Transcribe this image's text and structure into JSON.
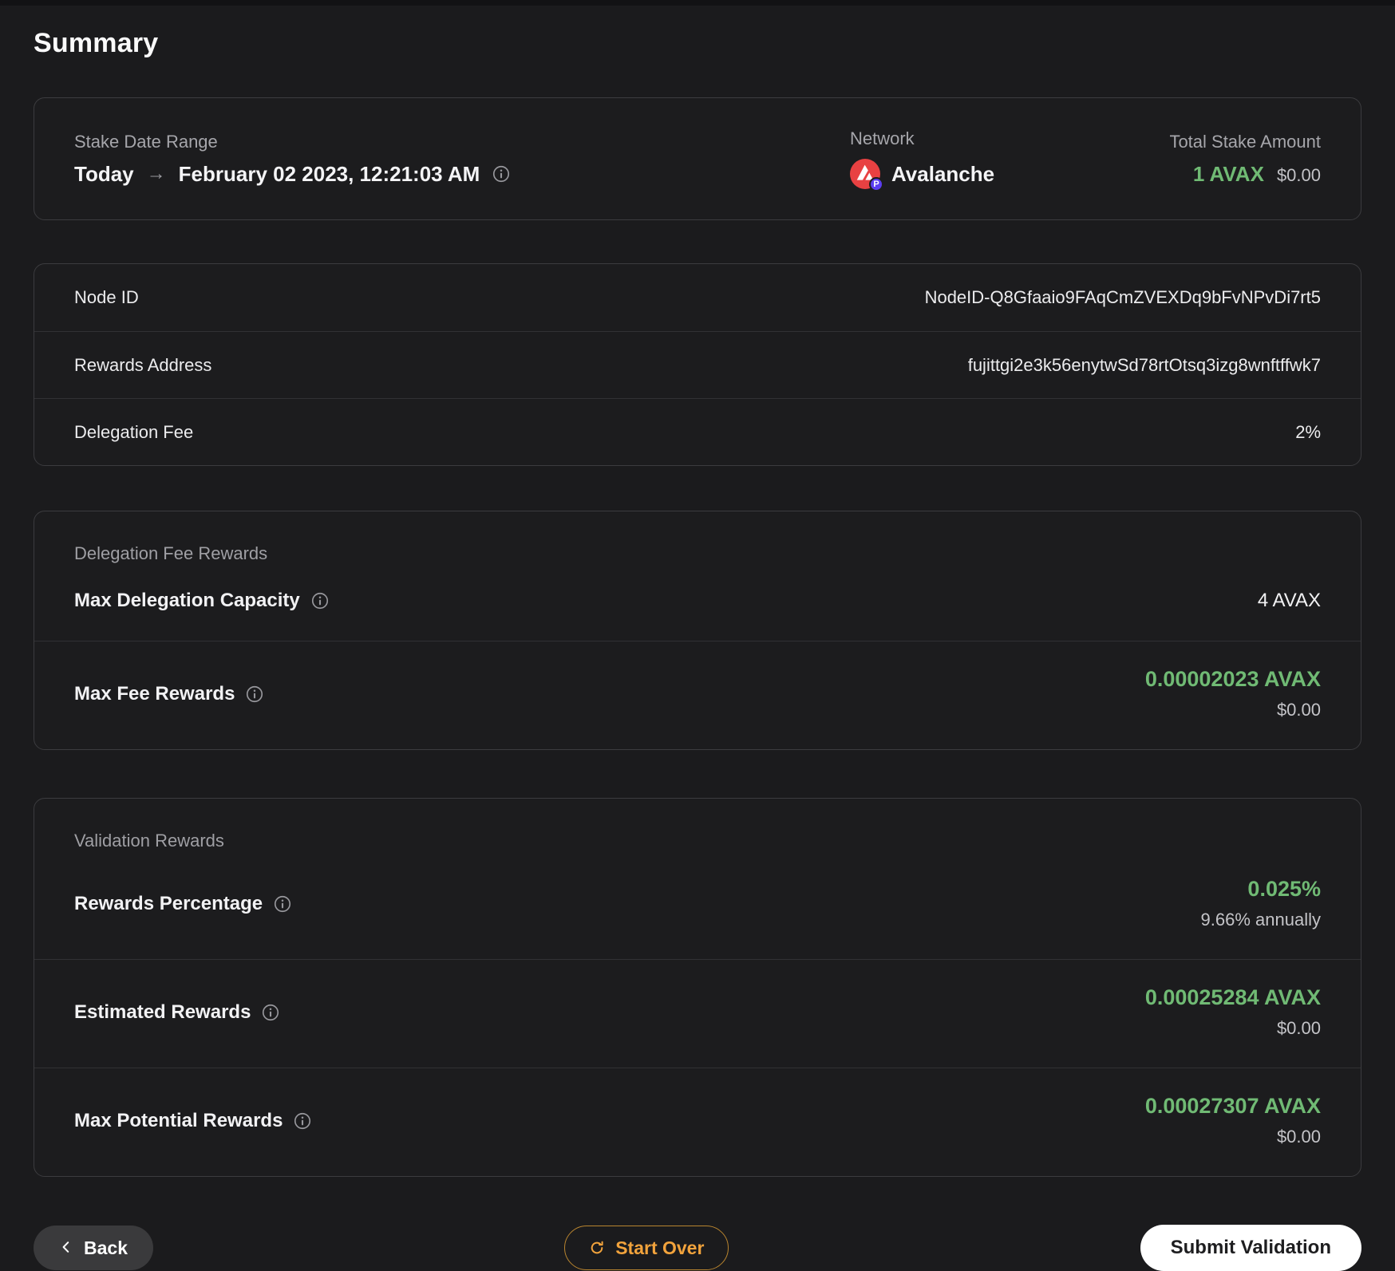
{
  "page": {
    "title": "Summary"
  },
  "colors": {
    "green": "#70ba74",
    "orange": "#f2a33c",
    "orange-border": "#b9852f",
    "avax-red": "#e84142",
    "badge-purple": "#5b3df0"
  },
  "overview": {
    "stake_date_range": {
      "label": "Stake Date Range",
      "from": "Today",
      "arrow": "→",
      "to": "February 02 2023, 12:21:03 AM"
    },
    "network": {
      "label": "Network",
      "name": "Avalanche",
      "badge": "P"
    },
    "total_stake": {
      "label": "Total Stake Amount",
      "amount": "1 AVAX",
      "usd": "$0.00"
    }
  },
  "details": {
    "rows": [
      {
        "label": "Node ID",
        "value": "NodeID-Q8Gfaaio9FAqCmZVEXDq9bFvNPvDi7rt5"
      },
      {
        "label": "Rewards Address",
        "value": "fujittgi2e3k56enytwSd78rtOtsq3izg8wnftffwk7"
      },
      {
        "label": "Delegation Fee",
        "value": "2%"
      }
    ]
  },
  "delegation_fee_rewards": {
    "title": "Delegation Fee Rewards",
    "max_delegation_capacity": {
      "label": "Max Delegation Capacity",
      "value": "4 AVAX"
    },
    "max_fee_rewards": {
      "label": "Max Fee Rewards",
      "value": "0.00002023 AVAX",
      "usd": "$0.00"
    }
  },
  "validation_rewards": {
    "title": "Validation Rewards",
    "rewards_percentage": {
      "label": "Rewards Percentage",
      "value": "0.025%",
      "sub": "9.66% annually"
    },
    "estimated_rewards": {
      "label": "Estimated Rewards",
      "value": "0.00025284 AVAX",
      "usd": "$0.00"
    },
    "max_potential_rewards": {
      "label": "Max Potential Rewards",
      "value": "0.00027307 AVAX",
      "usd": "$0.00"
    }
  },
  "footer": {
    "back_label": "Back",
    "start_over_label": "Start Over",
    "submit_label": "Submit Validation"
  }
}
